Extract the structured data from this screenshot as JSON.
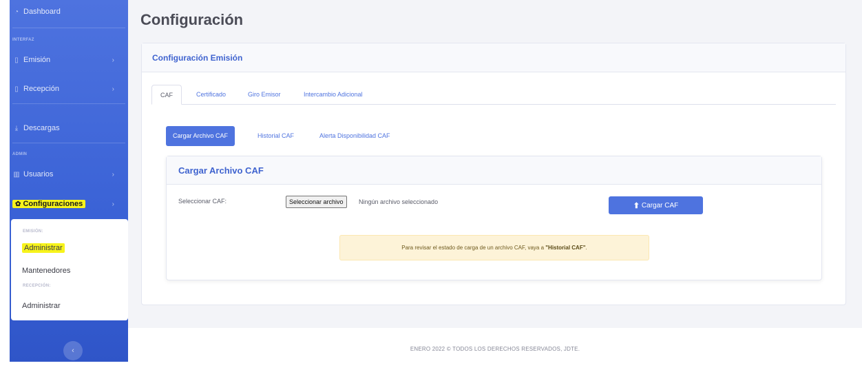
{
  "sidebar": {
    "dashboard": "Dashboard",
    "section_interfaz": "INTERFAZ",
    "emision": "Emisión",
    "recepcion": "Recepción",
    "descargas": "Descargas",
    "section_admin": "ADMIN",
    "usuarios": "Usuarios",
    "configuraciones": "Configuraciones",
    "chevron": "›",
    "submenu": {
      "head_emision": "EMISIÓN:",
      "administrar_1": "Administrar",
      "mantenedores": "Mantenedores",
      "head_recepcion": "RECEPCIÓN:",
      "administrar_2": "Administrar"
    },
    "toggle": "‹",
    "highlight_color": "#f7f31c"
  },
  "page": {
    "title": "Configuración"
  },
  "card": {
    "header": "Configuración Emisión",
    "tabs": [
      "CAF",
      "Certificado",
      "Giro Emisor",
      "Intercambio Adicional"
    ],
    "pills": [
      "Cargar Archivo CAF",
      "Historial CAF",
      "Alerta Disponibilidad CAF"
    ],
    "inner": {
      "header": "Cargar Archivo CAF",
      "select_label": "Seleccionar CAF:",
      "file_button": "Seleccionar archivo",
      "file_status": "Ningún archivo seleccionado",
      "upload_button": "Cargar CAF",
      "alert_prefix": "Para revisar el estado de carga de un archivo CAF, vaya a ",
      "alert_link": "\"Historial CAF\"",
      "alert_suffix": "."
    }
  },
  "footer": {
    "text": "ENERO 2022 © TODOS LOS DERECHOS RESERVADOS, JDTE."
  },
  "colors": {
    "primary": "#4e73df",
    "sidebar_dark": "#2f55c8"
  }
}
